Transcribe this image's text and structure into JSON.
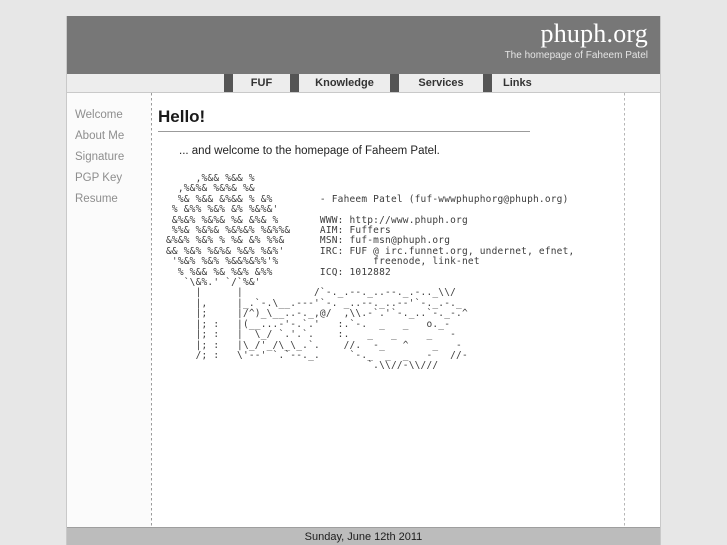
{
  "header": {
    "site_title": "phuph.org",
    "tagline": "The homepage of Faheem Patel"
  },
  "nav": {
    "tabs": [
      {
        "label": "FUF"
      },
      {
        "label": "Knowledge"
      },
      {
        "label": "Services"
      },
      {
        "label": "Links"
      }
    ]
  },
  "sidebar": {
    "items": [
      {
        "label": "Welcome"
      },
      {
        "label": "About Me"
      },
      {
        "label": "Signature"
      },
      {
        "label": "PGP Key"
      },
      {
        "label": "Resume"
      }
    ]
  },
  "main": {
    "heading": "Hello!",
    "intro": "... and welcome to the homepage of Faheem Patel.",
    "ascii_art": "     ,%&& %&& %\n  ,%&%& %&%& %&\n  %& %&& &%&& % &%        - Faheem Patel (fuf-wwwphuphorg@phuph.org)\n % &%% %&% &% %&%&'\n &%&% %&%& %& &%& %       WWW: http://www.phuph.org\n %%& %&%& %&%&% %&%%&     AIM: Fuffers\n&%&% %&% % %& &% %%&      MSN: fuf-msn@phuph.org\n&& %&% %&%& %&% %&%'      IRC: FUF @ irc.funnet.org, undernet, efnet,\n '%&% %&% %&&%&%%'%                freenode, link-net\n  % %&& %& %&% &%%        ICQ: 1012882\n   `\\&%.' `/`%&'\n     |      |            /`-._.--._..--._.-.._\\\\/\n     |,     |_.`-.\\__.---'`-. _..--._..--'`-._.-._\n     |;     |/^)_\\__..-._,@/  ,\\\\.-`.'`-._..`-._-.^\n     |; :   |(__...-'-.`.'   :.`-.  _   _   o._-\n     |; :   |  \\_/ `.'.`.    :.   _   _     _   -\n     |; :   |\\_/'_/\\_\\_.`.    //.  -_   ^    _   -\n     /; :   \\'--' `.`--._.     `-._  _  _   -   //-\n                                  `.\\\\//-\\\\///"
  },
  "footer": {
    "date": "Sunday, June 12th 2011"
  },
  "colors": {
    "page_background": "#e7e7e7",
    "header_gray": "#777777",
    "tab_separator": "#555555",
    "tab_face": "#ededed",
    "footer_bar": "#bcbcbc",
    "sidebar_text": "#8e8e8e"
  }
}
